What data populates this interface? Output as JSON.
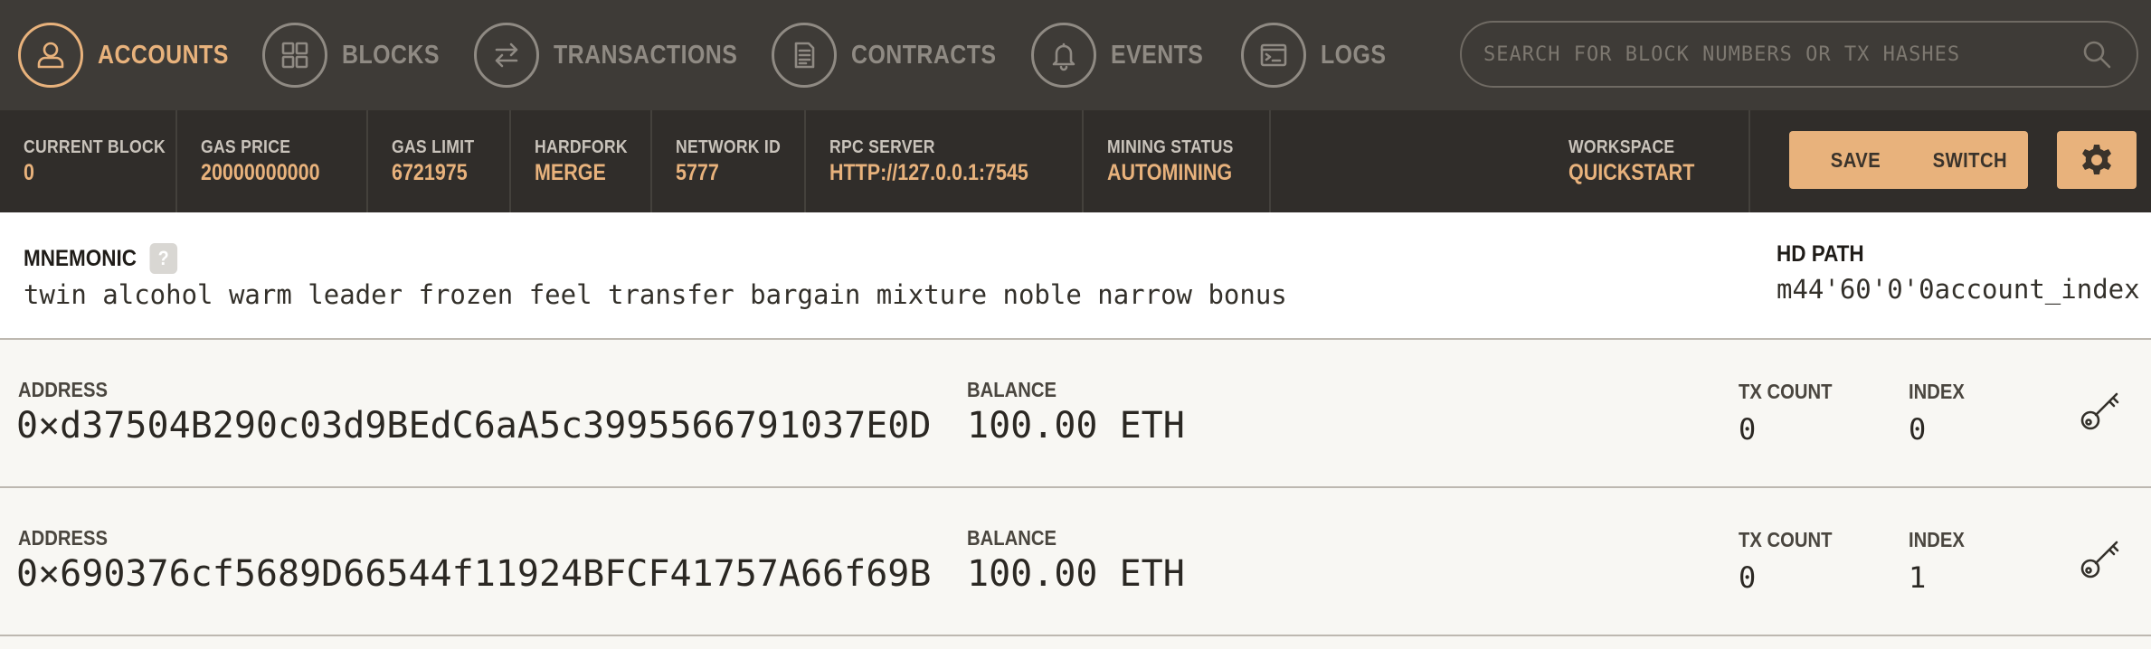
{
  "nav": {
    "items": [
      {
        "label": "ACCOUNTS",
        "icon": "user-icon",
        "active": true
      },
      {
        "label": "BLOCKS",
        "icon": "grid-icon",
        "active": false
      },
      {
        "label": "TRANSACTIONS",
        "icon": "transfer-arrows-icon",
        "active": false
      },
      {
        "label": "CONTRACTS",
        "icon": "document-icon",
        "active": false
      },
      {
        "label": "EVENTS",
        "icon": "bell-icon",
        "active": false
      },
      {
        "label": "LOGS",
        "icon": "terminal-icon",
        "active": false
      }
    ],
    "search_placeholder": "SEARCH FOR BLOCK NUMBERS OR TX HASHES"
  },
  "status": {
    "current_block": {
      "label": "CURRENT BLOCK",
      "value": "0"
    },
    "gas_price": {
      "label": "GAS PRICE",
      "value": "20000000000"
    },
    "gas_limit": {
      "label": "GAS LIMIT",
      "value": "6721975"
    },
    "hardfork": {
      "label": "HARDFORK",
      "value": "MERGE"
    },
    "network_id": {
      "label": "NETWORK ID",
      "value": "5777"
    },
    "rpc_server": {
      "label": "RPC SERVER",
      "value": "HTTP://127.0.0.1:7545"
    },
    "mining_status": {
      "label": "MINING STATUS",
      "value": "AUTOMINING"
    },
    "workspace": {
      "label": "WORKSPACE",
      "value": "QUICKSTART"
    },
    "save_label": "SAVE",
    "switch_label": "SWITCH",
    "settings_icon": "gear-icon"
  },
  "mnemonic": {
    "title": "MNEMONIC",
    "help": "?",
    "words": "twin alcohol warm leader frozen feel transfer bargain mixture noble narrow bonus",
    "hd_path_label": "HD PATH",
    "hd_path_value": "m44'60'0'0account_index"
  },
  "accounts": [
    {
      "address_label": "ADDRESS",
      "address": "0×d37504B290c03d9BEdC6aA5c3995566791037E0D",
      "balance_label": "BALANCE",
      "balance": "100.00 ETH",
      "tx_count_label": "TX COUNT",
      "tx_count": "0",
      "index_label": "INDEX",
      "index": "0"
    },
    {
      "address_label": "ADDRESS",
      "address": "0×690376cf5689D66544f11924BFCF41757A66f69B",
      "balance_label": "BALANCE",
      "balance": "100.00 ETH",
      "tx_count_label": "TX COUNT",
      "tx_count": "0",
      "index_label": "INDEX",
      "index": "1"
    }
  ],
  "colors": {
    "accent": "#e8b27c",
    "nav_bg": "#3e3b37",
    "status_bg": "#302d2a",
    "muted": "#8f8a83"
  }
}
